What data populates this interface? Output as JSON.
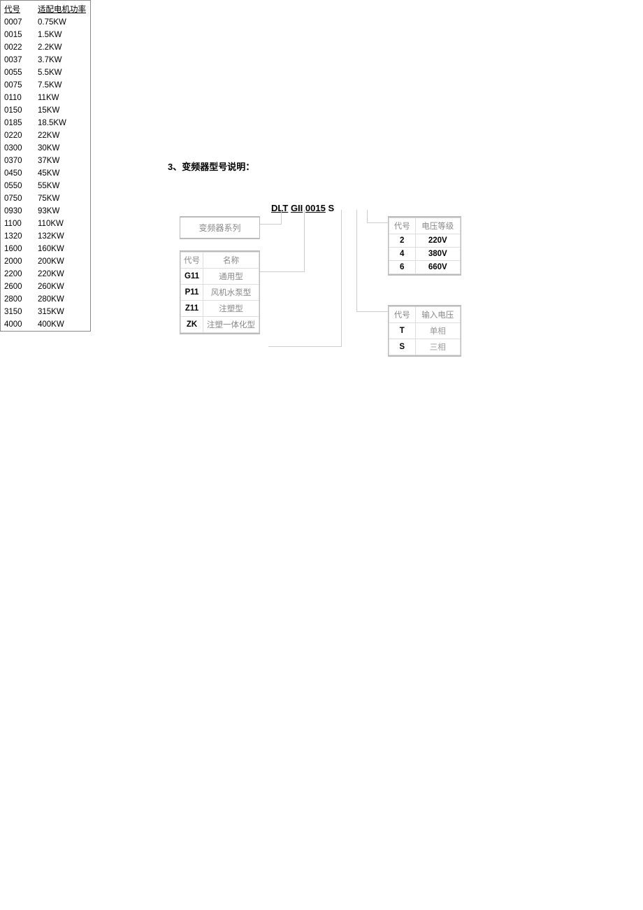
{
  "heading": "3、变频器型号说明：",
  "model": {
    "p1": "DLT",
    "p2": "GII",
    "p3": "0015",
    "p4": "S"
  },
  "series_label": "变频器系列",
  "type_table": {
    "headers": [
      "代号",
      "名称"
    ],
    "rows": [
      [
        "G11",
        "通用型"
      ],
      [
        "P11",
        "风机水泵型"
      ],
      [
        "Z11",
        "注塑型"
      ],
      [
        "ZK",
        "注塑一体化型"
      ]
    ]
  },
  "power_table": {
    "headers": [
      "代号",
      "适配电机功率"
    ],
    "rows": [
      [
        "0007",
        "0.75KW"
      ],
      [
        "0015",
        "1.5KW"
      ],
      [
        "0022",
        "2.2KW"
      ],
      [
        "0037",
        "3.7KW"
      ],
      [
        "0055",
        "5.5KW"
      ],
      [
        "0075",
        "7.5KW"
      ],
      [
        "0110",
        "11KW"
      ],
      [
        "0150",
        "15KW"
      ],
      [
        "0185",
        "18.5KW"
      ],
      [
        "0220",
        "22KW"
      ],
      [
        "0300",
        "30KW"
      ],
      [
        "0370",
        "37KW"
      ],
      [
        "0450",
        "45KW"
      ],
      [
        "0550",
        "55KW"
      ],
      [
        "0750",
        "75KW"
      ],
      [
        "0930",
        "93KW"
      ],
      [
        "1100",
        "110KW"
      ],
      [
        "1320",
        "132KW"
      ],
      [
        "1600",
        "160KW"
      ],
      [
        "2000",
        "200KW"
      ],
      [
        "2200",
        "220KW"
      ],
      [
        "2600",
        "260KW"
      ],
      [
        "2800",
        "280KW"
      ],
      [
        "3150",
        "315KW"
      ],
      [
        "4000",
        "400KW"
      ]
    ]
  },
  "voltage_table": {
    "headers": [
      "代号",
      "电压等级"
    ],
    "rows": [
      [
        "2",
        "220V"
      ],
      [
        "4",
        "380V"
      ],
      [
        "6",
        "660V"
      ]
    ]
  },
  "input_table": {
    "headers": [
      "代号",
      "输入电压"
    ],
    "rows": [
      [
        "T",
        "单相"
      ],
      [
        "S",
        "三相"
      ]
    ]
  }
}
